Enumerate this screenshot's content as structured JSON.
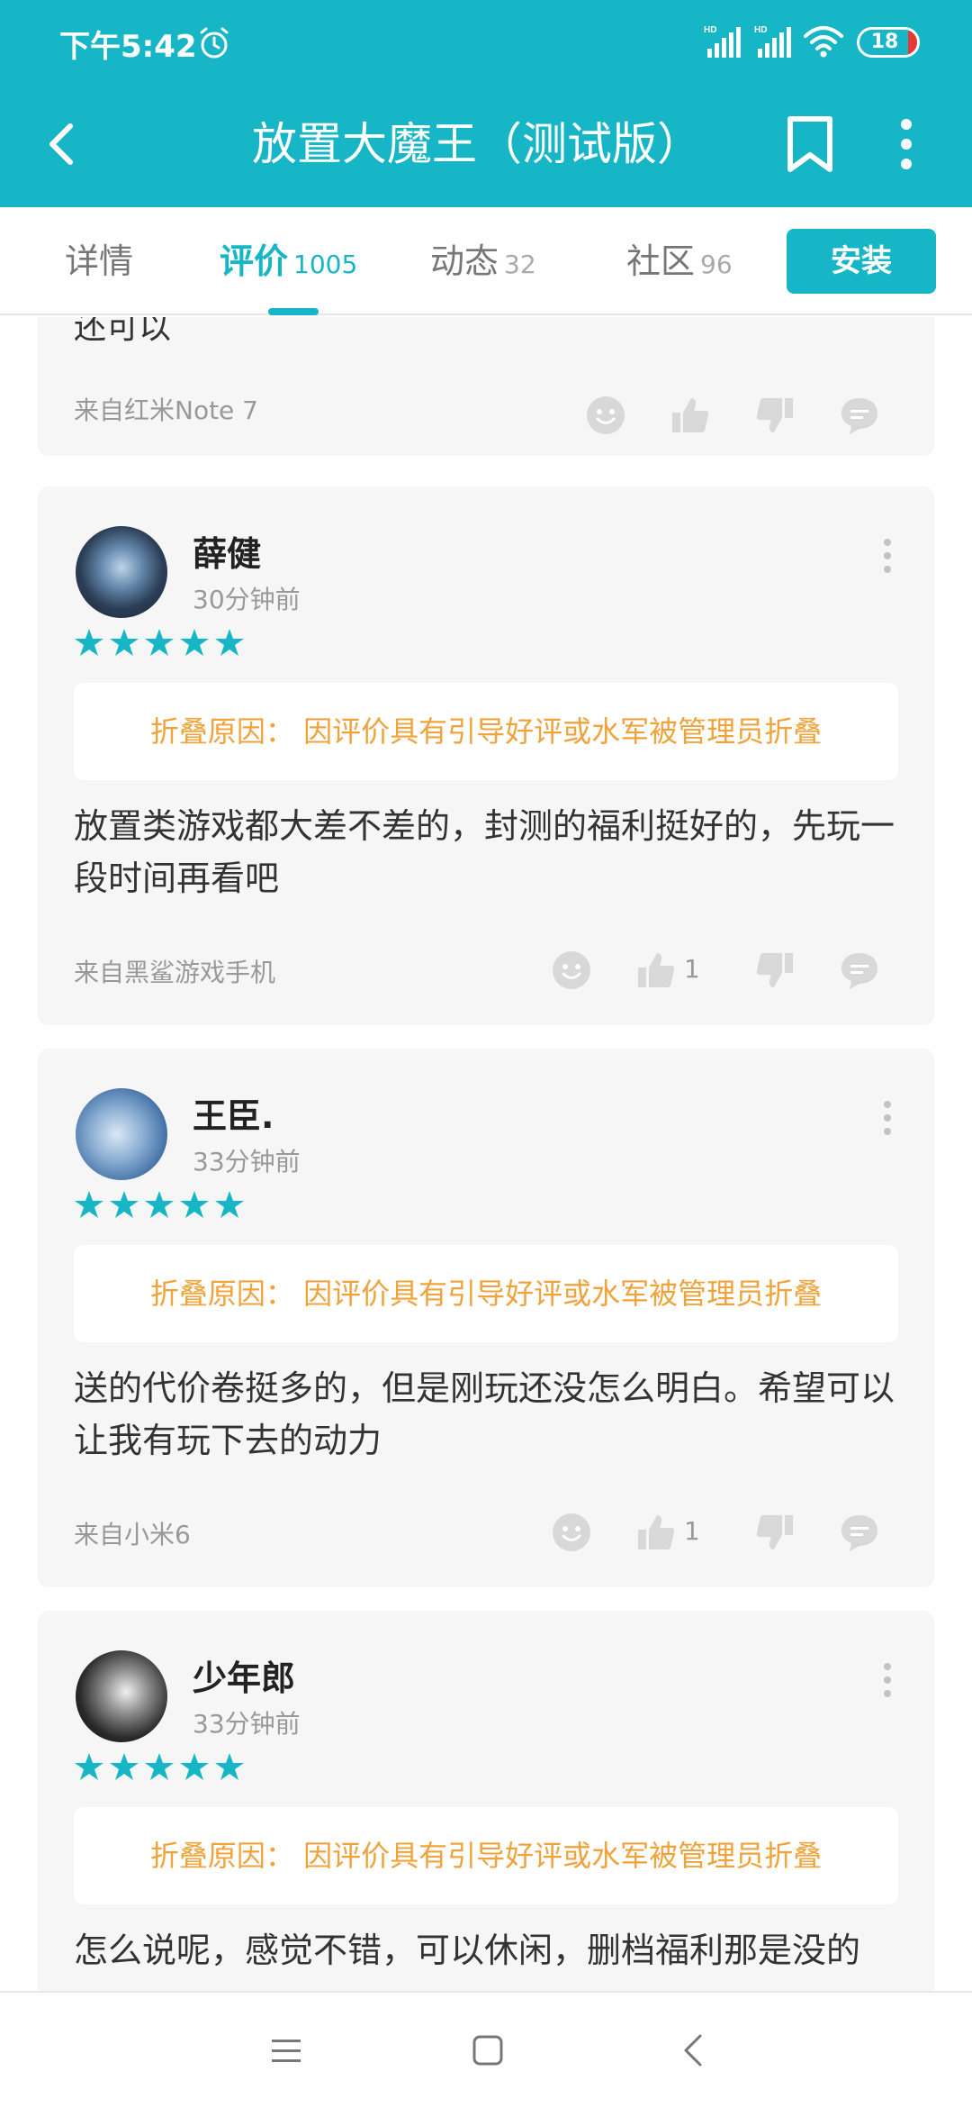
{
  "status_bar": {
    "time": "下午5:42",
    "battery": "18",
    "icons": [
      "alarm-icon",
      "hd-signal-icon",
      "hd-signal-icon",
      "wifi-icon",
      "battery-icon"
    ]
  },
  "app_bar": {
    "title": "放置大魔王（测试版）",
    "back_icon": "chevron-left-icon",
    "bookmark_icon": "bookmark-icon",
    "more_icon": "more-vertical-icon"
  },
  "tabs": [
    {
      "label": "详情",
      "count": ""
    },
    {
      "label": "评价",
      "count": "1005"
    },
    {
      "label": "动态",
      "count": "32"
    },
    {
      "label": "社区",
      "count": "96"
    }
  ],
  "install_label": "安装",
  "partial_review": {
    "text": "还可以",
    "device": "来自红米Note 7"
  },
  "reviews": [
    {
      "user": "薛健",
      "time": "30分钟前",
      "rating": 5,
      "fold_reason": "折叠原因：  因评价具有引导好评或水军被管理员折叠",
      "text": "放置类游戏都大差不差的，封测的福利挺好的，先玩一段时间再看吧",
      "device": "来自黑鲨游戏手机",
      "likes": "1"
    },
    {
      "user": "王臣.",
      "time": "33分钟前",
      "rating": 5,
      "fold_reason": "折叠原因：  因评价具有引导好评或水军被管理员折叠",
      "text": "送的代价卷挺多的，但是刚玩还没怎么明白。希望可以让我有玩下去的动力",
      "device": "来自小米6",
      "likes": "1"
    },
    {
      "user": "少年郎",
      "time": "33分钟前",
      "rating": 5,
      "fold_reason": "折叠原因：  因评价具有引导好评或水军被管理员折叠",
      "text": "怎么说呢，感觉不错，可以休闲，删档福利那是没的"
    }
  ],
  "colors": {
    "accent": "#17b6c7",
    "fold_text": "#f0a33a",
    "card_bg": "#f6f6f6"
  },
  "nav_bar": {
    "icons": [
      "menu-icon",
      "home-square-icon",
      "back-triangle-icon"
    ]
  }
}
